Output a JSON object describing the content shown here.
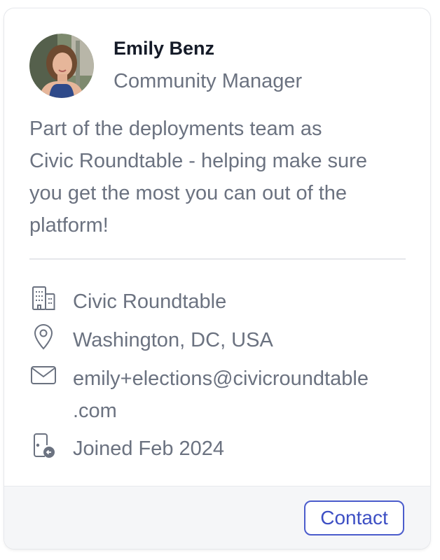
{
  "profile": {
    "name": "Emily Benz",
    "role": "Community Manager",
    "bio_lines": [
      "Part of the deployments team as",
      "Civic Roundtable - helping make sure",
      "you get the most you can out of the",
      "platform!"
    ]
  },
  "details": {
    "organization": {
      "icon": "building-icon",
      "text": "Civic Roundtable"
    },
    "location": {
      "icon": "location-pin-icon",
      "text": "Washington, DC, USA"
    },
    "email": {
      "icon": "mail-icon",
      "lines": [
        "emily+elections@civicroundtable",
        ".com"
      ]
    },
    "joined": {
      "icon": "joined-calendar-icon",
      "text": "Joined Feb 2024"
    }
  },
  "footer": {
    "contact_label": "Contact"
  },
  "colors": {
    "text_primary": "#151b28",
    "text_secondary": "#6b7280",
    "accent": "#3d4fc4",
    "footer_bg": "#f5f6f8"
  }
}
